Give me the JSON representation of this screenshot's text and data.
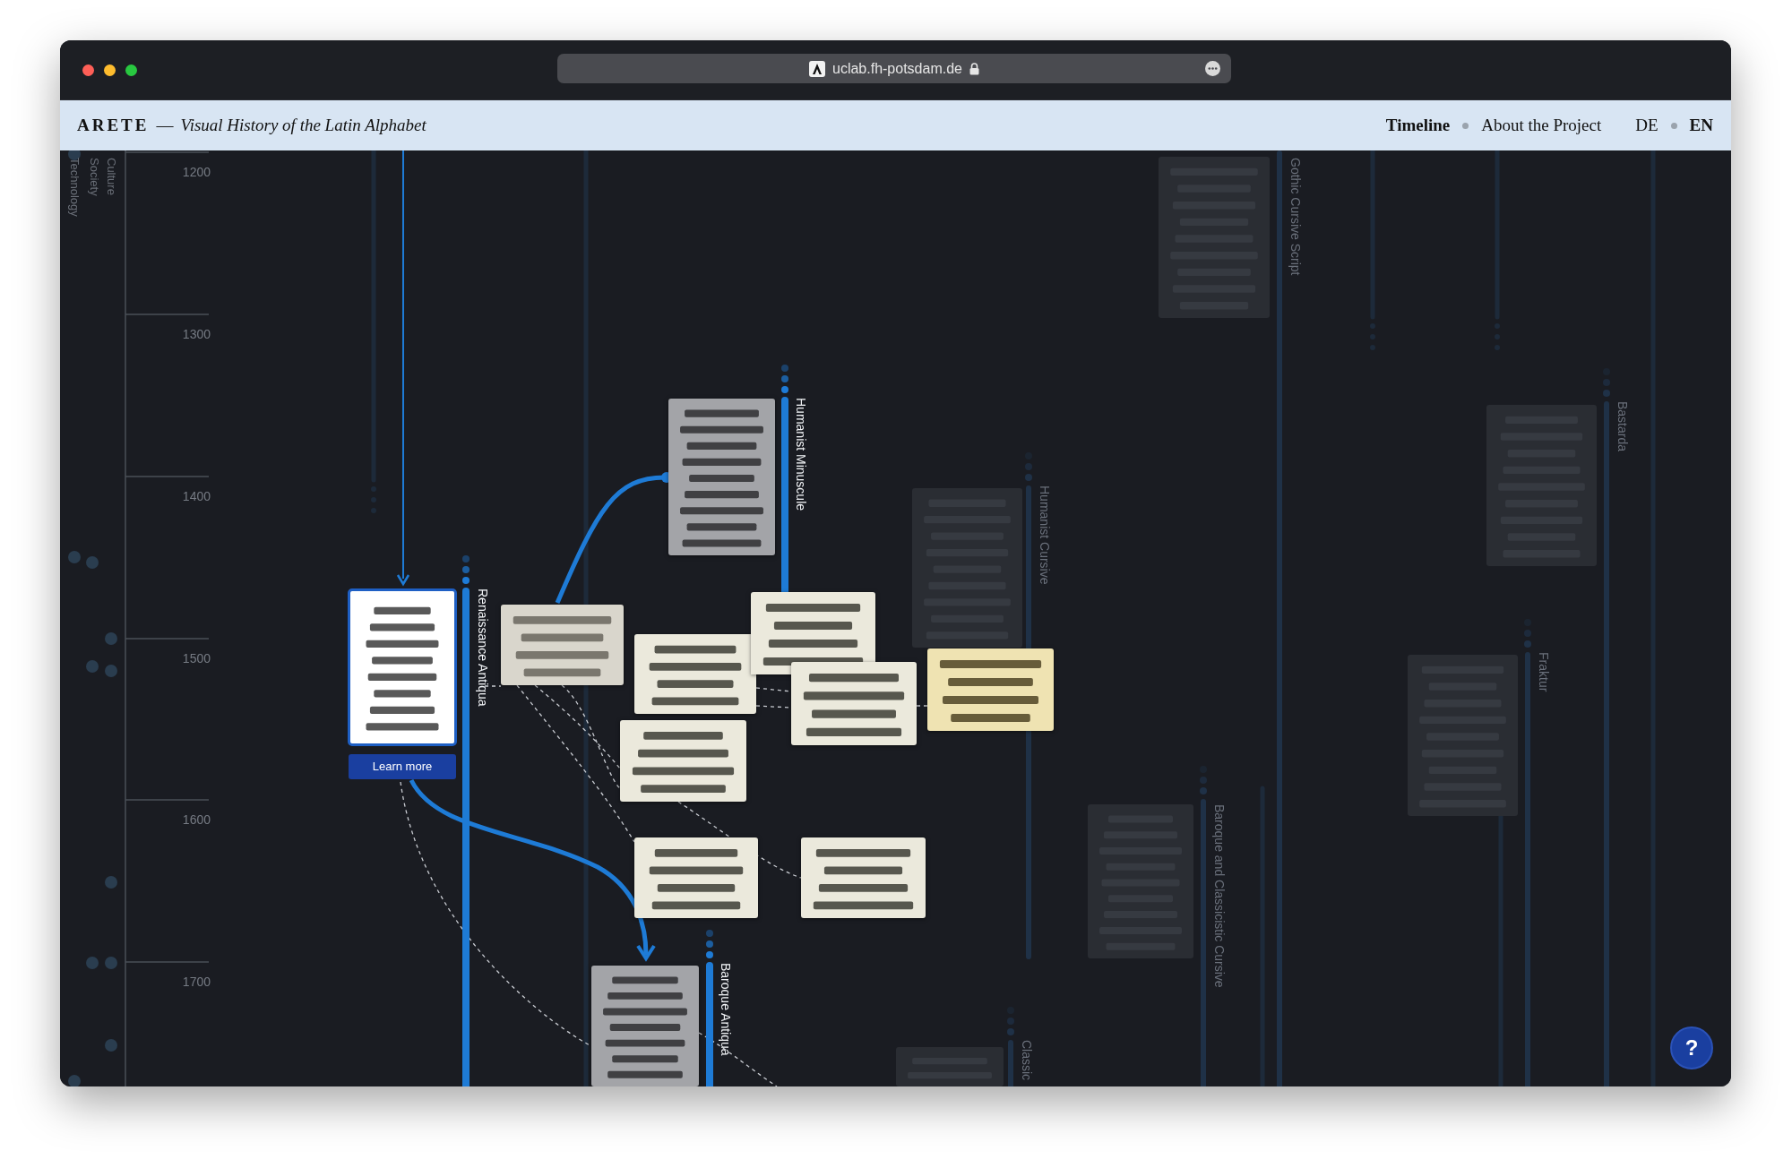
{
  "browser": {
    "url": "uclab.fh-potsdam.de"
  },
  "header": {
    "logo": "ARETE",
    "separator": "—",
    "subtitle": "Visual History of the Latin Alphabet",
    "nav": [
      {
        "label": "Timeline",
        "selected": true
      },
      {
        "label": "About the Project",
        "selected": false
      }
    ],
    "languages": [
      {
        "label": "DE",
        "selected": false
      },
      {
        "label": "EN",
        "selected": true
      }
    ]
  },
  "lanes": [
    "Culture",
    "Society",
    "Technology"
  ],
  "axis": {
    "ticks": [
      "1200",
      "1300",
      "1400",
      "1500",
      "1600",
      "1700"
    ]
  },
  "streams": [
    {
      "label": "Renaissance Antiqua",
      "active": true
    },
    {
      "label": "Humanist Minuscule",
      "active": true
    },
    {
      "label": "Baroque Antiqua",
      "active": true
    },
    {
      "label": "Humanist Cursive",
      "active": false
    },
    {
      "label": "Gothic Cursive Script",
      "active": false
    },
    {
      "label": "Bastarda",
      "active": false
    },
    {
      "label": "Fraktur",
      "active": false
    },
    {
      "label": "Baroque and Classicistic Cursive",
      "active": false
    },
    {
      "label": "Classic",
      "active": false
    }
  ],
  "specimens": [
    {
      "kind": "picture",
      "selected": true,
      "active": true
    },
    {
      "kind": "picture",
      "selected": false,
      "active": true
    },
    {
      "kind": "picture",
      "selected": false,
      "active": true
    },
    {
      "kind": "picture",
      "selected": false,
      "active": true
    },
    {
      "kind": "picture",
      "selected": false,
      "active": true
    },
    {
      "kind": "picture",
      "selected": false,
      "active": true
    },
    {
      "kind": "picture",
      "selected": false,
      "active": true
    },
    {
      "kind": "picture",
      "selected": false,
      "active": true
    },
    {
      "kind": "picture",
      "selected": false,
      "active": true
    },
    {
      "kind": "picture",
      "selected": false,
      "active": true
    },
    {
      "kind": "picture",
      "selected": false,
      "active": true
    },
    {
      "kind": "picture",
      "selected": false,
      "active": false
    },
    {
      "kind": "picture",
      "selected": false,
      "active": false
    },
    {
      "kind": "picture",
      "selected": false,
      "active": false
    },
    {
      "kind": "picture",
      "selected": false,
      "active": false
    },
    {
      "kind": "picture",
      "selected": false,
      "active": false
    },
    {
      "kind": "picture",
      "selected": false,
      "active": false
    }
  ],
  "learn_more": "Learn more",
  "help": "?"
}
